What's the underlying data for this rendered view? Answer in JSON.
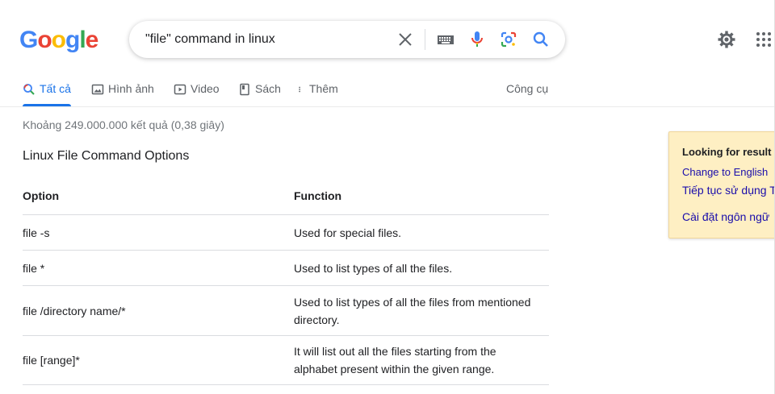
{
  "header": {
    "logo_text": "Google",
    "logo_colors": [
      "#4285F4",
      "#EA4335",
      "#FBBC05",
      "#4285F4",
      "#34A853",
      "#EA4335"
    ],
    "search": {
      "value": "\"file\" command in linux"
    },
    "icons": [
      "clear-icon",
      "keyboard-icon",
      "microphone-icon",
      "lens-camera-icon",
      "search-icon",
      "settings-gear-icon",
      "apps-grid-icon"
    ]
  },
  "tabs": [
    {
      "label": "Tất cả",
      "icon": "search-icon",
      "active": true
    },
    {
      "label": "Hình ảnh",
      "icon": "image-icon"
    },
    {
      "label": "Video",
      "icon": "play-icon"
    },
    {
      "label": "Sách",
      "icon": "book-icon"
    },
    {
      "label": "Thêm",
      "icon": "more-vert-icon"
    }
  ],
  "tools_label": "Công cụ",
  "result_stats": "Khoảng 249.000.000 kết quả (0,38 giây)",
  "snippet": {
    "title": "Linux File Command Options",
    "columns": [
      "Option",
      "Function"
    ],
    "rows": [
      {
        "option": "file -s",
        "function": [
          "Used for special files."
        ]
      },
      {
        "option": "file *",
        "function": [
          "Used to list types of all the files."
        ]
      },
      {
        "option": "file /directory name/*",
        "function": [
          "Used to list types of all the files from mentioned",
          "directory."
        ]
      },
      {
        "option": "file [range]*",
        "function": [
          "It will list out all the files starting from the",
          "alphabet present within the given range."
        ]
      }
    ]
  },
  "language_popup": {
    "title": "Looking for result",
    "links": [
      "Change to English",
      "Tiếp tục sử dụng T",
      "Cài đặt ngôn ngữ"
    ]
  },
  "colors": {
    "accent": "#1a73e8",
    "link": "#1a0dab",
    "popup_bg": "#feefc3"
  }
}
